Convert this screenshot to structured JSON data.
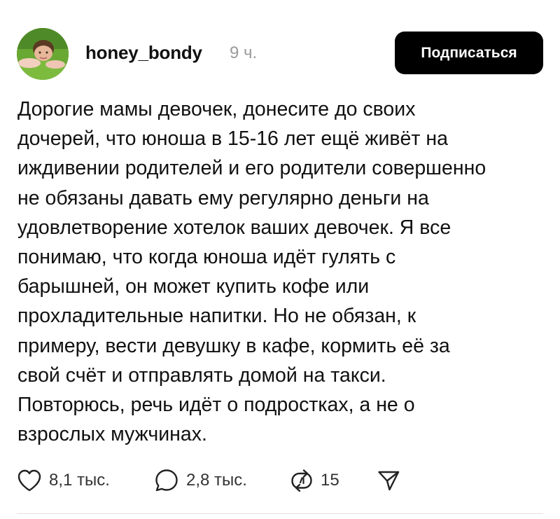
{
  "post": {
    "username": "honey_bondy",
    "timestamp": "9 ч.",
    "follow_label": "Подписаться",
    "text_lines": [
      "Дорогие мамы девочек, донесите до своих",
      "дочерей, что юноша в 15-16 лет ещё живёт на",
      "иждивении родителей и его родители совершенно",
      "не обязаны давать ему регулярно деньги на",
      "удовлетворение хотелок ваших девочек. Я все",
      "понимаю, что когда юноша идёт гулять с",
      "барышней, он может купить кофе или",
      "прохладительные напитки. Но не обязан, к",
      "примеру, вести девушку в кафе, кормить её за",
      "свой счёт и отправлять домой на такси.",
      "Повторюсь, речь идёт о подростках, а не о",
      "взрослых мужчинах."
    ]
  },
  "actions": {
    "likes": "8,1 тыс.",
    "comments": "2,8 тыс.",
    "reposts": "15"
  },
  "icons": {
    "like": "heart-icon",
    "comment": "comment-bubble-icon",
    "repost": "repost-icon",
    "share": "send-icon"
  },
  "colors": {
    "button_bg": "#000000",
    "button_text": "#ffffff",
    "timestamp": "#9a9a9a",
    "text": "#111111"
  }
}
